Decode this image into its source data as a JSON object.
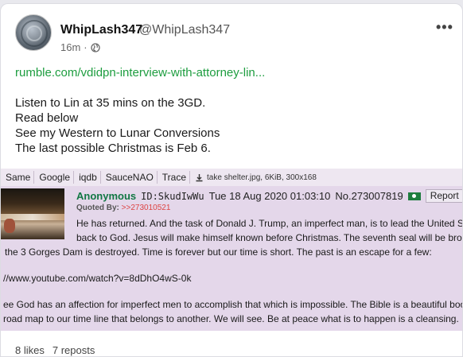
{
  "post": {
    "display_name": "WhipLash347",
    "handle": "@WhipLash347",
    "time": "16m",
    "separator": "·",
    "link": "rumble.com/vdidpn-interview-with-attorney-lin...",
    "lines": [
      "Listen to Lin at 35 mins on the 3GD.",
      "Read below",
      "See my Western to Lunar Conversions",
      "The last possible Christmas is Feb 6."
    ],
    "more_label": "•••",
    "likes": "8 likes",
    "reposts": "7 reposts"
  },
  "embed": {
    "toolbar": [
      "Same",
      "Google",
      "iqdb",
      "SauceNAO",
      "Trace"
    ],
    "file_info": "take shelter.jpg, 6KiB, 300x168",
    "poster": "Anonymous",
    "id": "ID:SkudIwWu",
    "date": "Tue 18 Aug 2020 01:03:10",
    "post_no": "No.273007819",
    "report_label": "Report",
    "quoted_label": "Quoted By:",
    "quoted_ref": ">>273010521",
    "text_lines": [
      "He has returned. And the task of Donald J. Trump, an imperfect man, is to lead the United St",
      "back to God. Jesus will make himself known before Christmas. The seventh seal will be brok",
      "the 3 Gorges Dam is destroyed. Time is forever but our time is short. The past is an escape for a few:",
      "//www.youtube.com/watch?v=8dDhO4wS-0k",
      "ee God has an affection for imperfect men to accomplish that which is impossible. The Bible is a beautiful boo",
      "road map to our time line that belongs to another. We will see. Be at peace what is to happen is a cleansing."
    ]
  },
  "colors": {
    "link": "#1d9d3f",
    "embed_bg": "#e4d7ea",
    "poster": "#117743"
  }
}
